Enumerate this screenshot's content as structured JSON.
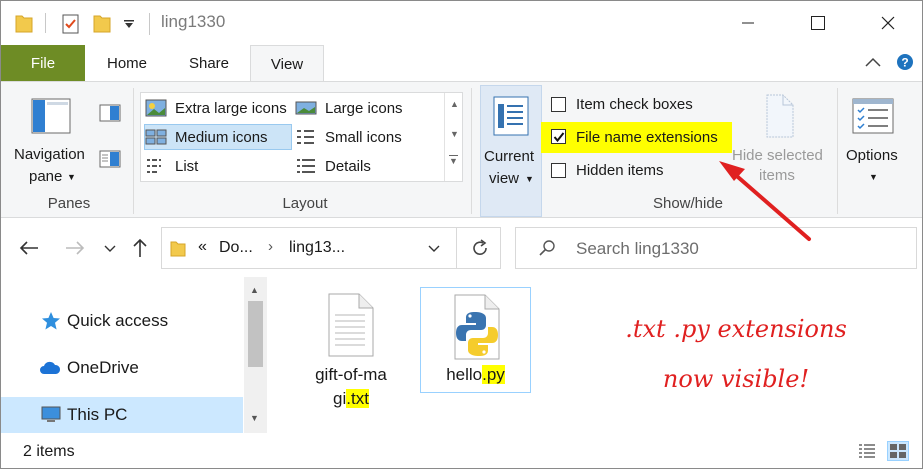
{
  "window": {
    "title": "ling1330"
  },
  "tabs": {
    "file": "File",
    "home": "Home",
    "share": "Share",
    "view": "View"
  },
  "panes": {
    "nav_line1": "Navigation",
    "nav_line2": "pane",
    "group": "Panes"
  },
  "layout": {
    "items": [
      "Extra large icons",
      "Large icons",
      "Medium icons",
      "Small icons",
      "List",
      "Details"
    ],
    "selected": "Medium icons",
    "group": "Layout"
  },
  "current_view": {
    "line1": "Current",
    "line2": "view"
  },
  "show_hide": {
    "item_check_boxes": "Item check boxes",
    "file_name_extensions": "File name extensions",
    "hidden_items": "Hidden items",
    "hide_selected_line1": "Hide selected",
    "hide_selected_line2": "items",
    "group": "Show/hide",
    "file_name_extensions_checked": true,
    "item_check_boxes_checked": false,
    "hidden_items_checked": false
  },
  "options": {
    "label": "Options"
  },
  "address": {
    "prefix": "«",
    "seg1": "Do...",
    "seg2": "ling13..."
  },
  "search": {
    "placeholder": "Search ling1330"
  },
  "nav_pane": {
    "items": [
      "Quick access",
      "OneDrive",
      "This PC"
    ],
    "selected": "This PC"
  },
  "files": [
    {
      "name_part1": "gift-of-ma",
      "name_part2_plain": "gi",
      "name_ext": ".txt",
      "icon": "text-file-icon"
    },
    {
      "name_plain": "hello",
      "name_ext": ".py",
      "icon": "python-file-icon"
    }
  ],
  "annotation": {
    "line1": ".txt .py extensions",
    "line2": "now visible!"
  },
  "status": {
    "count": "2 items"
  },
  "colors": {
    "file_tab": "#6e8c25",
    "highlight": "#ffff00",
    "annotation": "#e02020",
    "selection": "#cce8ff"
  }
}
